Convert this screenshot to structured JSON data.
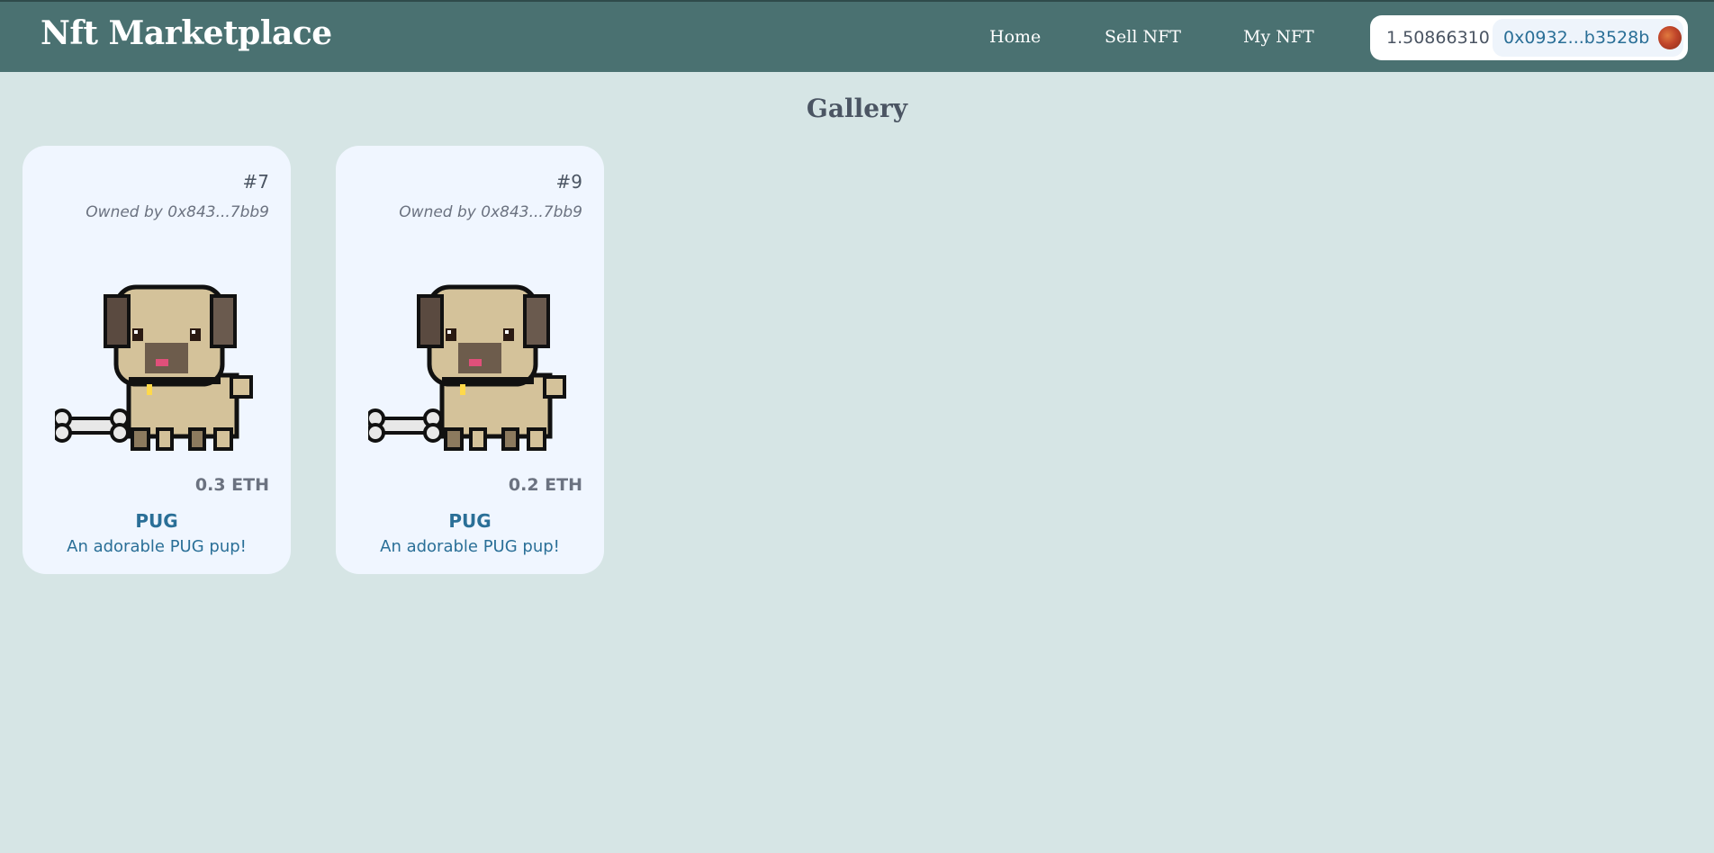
{
  "header": {
    "brand": "Nft Marketplace",
    "nav": [
      {
        "label": "Home"
      },
      {
        "label": "Sell NFT"
      },
      {
        "label": "My NFT"
      }
    ],
    "wallet": {
      "balance": "1.50866310",
      "address": "0x0932...b3528b",
      "avatar_icon": "wallet-avatar-icon"
    }
  },
  "page": {
    "title": "Gallery"
  },
  "cards": [
    {
      "id": "#7",
      "owner": "Owned by 0x843...7bb9",
      "image_icon": "pug-pixel-art",
      "price": "0.3 ETH",
      "name": "PUG",
      "description": "An adorable PUG pup!"
    },
    {
      "id": "#9",
      "owner": "Owned by 0x843...7bb9",
      "image_icon": "pug-pixel-art",
      "price": "0.2 ETH",
      "name": "PUG",
      "description": "An adorable PUG pup!"
    }
  ],
  "colors": {
    "header_bg": "#4a7171",
    "page_bg": "#d6e5e5",
    "card_bg": "#f0f6ff",
    "accent": "#2a6f97"
  }
}
